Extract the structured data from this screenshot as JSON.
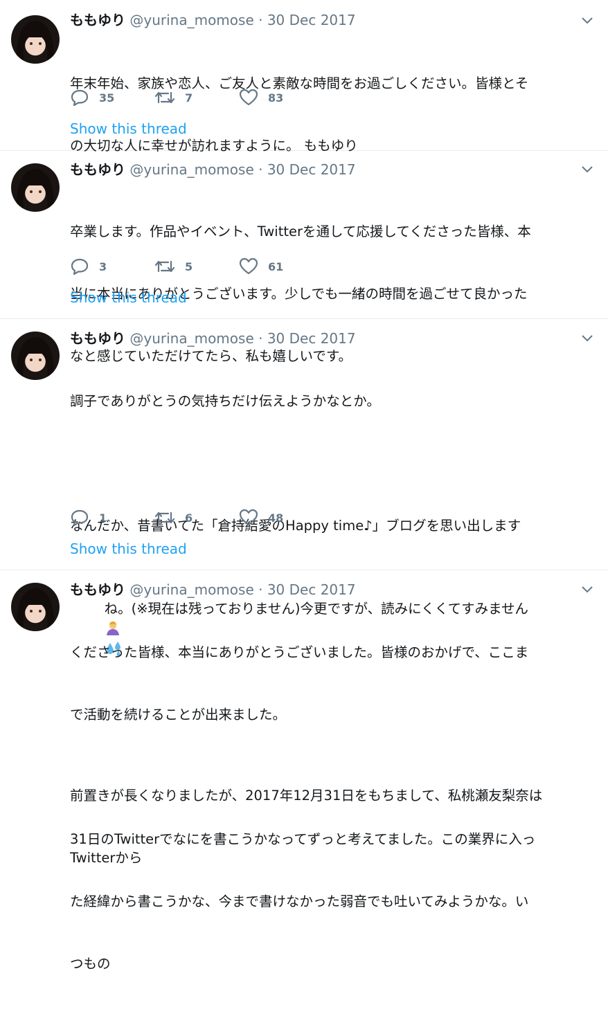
{
  "tweets": [
    {
      "name": "ももゆり",
      "handle": "@yurina_momose",
      "sep": "·",
      "date": "30 Dec 2017",
      "lines": [
        "年末年始、家族や恋人、ご友人と素敵な時間をお過ごしください。皆様とそ",
        "の大切な人に幸せが訪れますように。 ももゆり"
      ],
      "replies": "35",
      "retweets": "7",
      "likes": "83",
      "thread": "Show this thread"
    },
    {
      "name": "ももゆり",
      "handle": "@yurina_momose",
      "sep": "·",
      "date": "30 Dec 2017",
      "lines": [
        "卒業します。作品やイベント、Twitterを通して応援してくださった皆様、本",
        "当に本当にありがとうございます。少しでも一緒の時間を過ごせて良かった",
        "なと感じていただけてたら、私も嬉しいです。"
      ],
      "replies": "3",
      "retweets": "5",
      "likes": "61",
      "thread": "Show this thread"
    },
    {
      "name": "ももゆり",
      "handle": "@yurina_momose",
      "sep": "·",
      "date": "30 Dec 2017",
      "lines": [
        "調子でありがとうの気持ちだけ伝えようかなとか。",
        "",
        "なんだか、昔書いてた「倉持結愛のHappy time♪」ブログを思い出します",
        "ね。(※現在は残っておりません)今更ですが、読みにくくてすみません",
        "",
        "前置きが長くなりましたが、2017年12月31日をもちまして、私桃瀬友梨奈は",
        "Twitterから"
      ],
      "replies": "1",
      "retweets": "6",
      "likes": "48",
      "thread": "Show this thread",
      "emoji": [
        "person-bowing-icon",
        "sweat-droplets-icon"
      ]
    },
    {
      "name": "ももゆり",
      "handle": "@yurina_momose",
      "sep": "·",
      "date": "30 Dec 2017",
      "lines": [
        "くださった皆様、本当にありがとうございました。皆様のおかげで、ここま",
        "で活動を続けることが出来ました。",
        "",
        "31日のTwitterでなにを書こうかなってずっと考えてました。この業界に入っ",
        "た経緯から書こうかな、今まで書けなかった弱音でも吐いてみようかな。い",
        "つもの"
      ]
    }
  ],
  "colors": {
    "link": "#1da1f2",
    "muted": "#657786",
    "divider": "#e6ecf0",
    "text": "#14171a"
  }
}
